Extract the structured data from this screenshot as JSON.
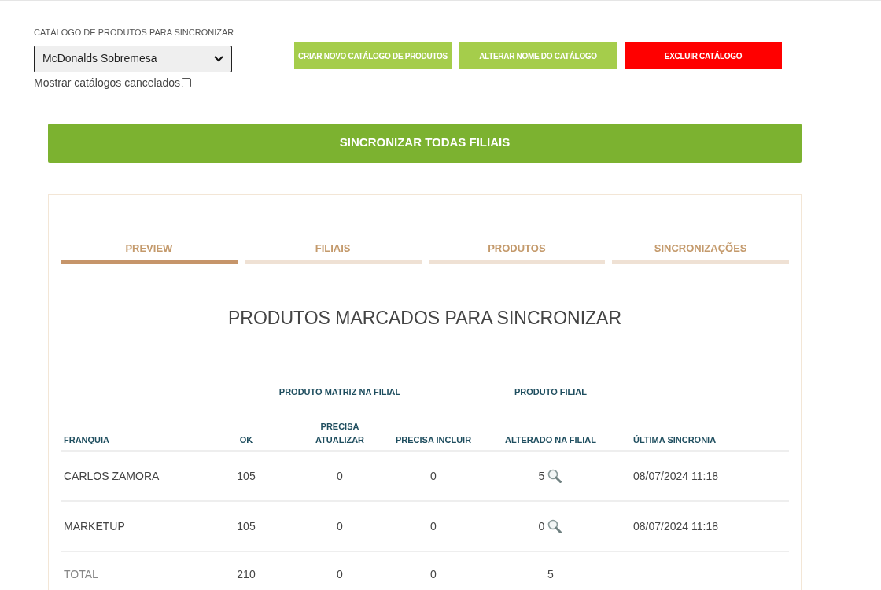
{
  "catalog": {
    "label": "CATÁLOGO DE PRODUTOS PARA SINCRONIZAR",
    "value": "McDonalds Sobremesa",
    "show_canceled_label": "Mostrar catálogos cancelados",
    "show_canceled_checked": false
  },
  "actions": [
    {
      "label": "CRIAR NOVO CATÁLOGO DE PRODUTOS",
      "kind": "primary"
    },
    {
      "label": "ALTERAR NOME DO CATÁLOGO",
      "kind": "primary"
    },
    {
      "label": "EXCLUIR CATÁLOGO",
      "kind": "danger"
    }
  ],
  "sync_all_button": "SINCRONIZAR TODAS FILIAIS",
  "tabs": [
    {
      "label": "PREVIEW",
      "selected": true
    },
    {
      "label": "FILIAIS",
      "selected": false
    },
    {
      "label": "PRODUTOS",
      "selected": false
    },
    {
      "label": "SINCRONIZAÇÕES",
      "selected": false
    }
  ],
  "section_title": "PRODUTOS MARCADOS PARA SINCRONIZAR",
  "table": {
    "group_headers": [
      "PRODUTO MATRIZ NA FILIAL",
      "PRODUTO FILIAL"
    ],
    "columns": [
      "FRANQUIA",
      "OK",
      "PRECISA ATUALIZAR",
      "PRECISA INCLUIR",
      "ALTERADO NA FILIAL",
      "ÚLTIMA SINCRONIA"
    ],
    "rows": [
      {
        "franquia": "CARLOS ZAMORA",
        "ok": "105",
        "atualizar": "0",
        "incluir": "0",
        "alterado": "5",
        "ultima": "08/07/2024 11:18"
      },
      {
        "franquia": "MARKETUP",
        "ok": "105",
        "atualizar": "0",
        "incluir": "0",
        "alterado": "0",
        "ultima": "08/07/2024 11:18"
      }
    ],
    "total": {
      "label": "TOTAL",
      "ok": "210",
      "atualizar": "0",
      "incluir": "0",
      "alterado": "5"
    }
  }
}
